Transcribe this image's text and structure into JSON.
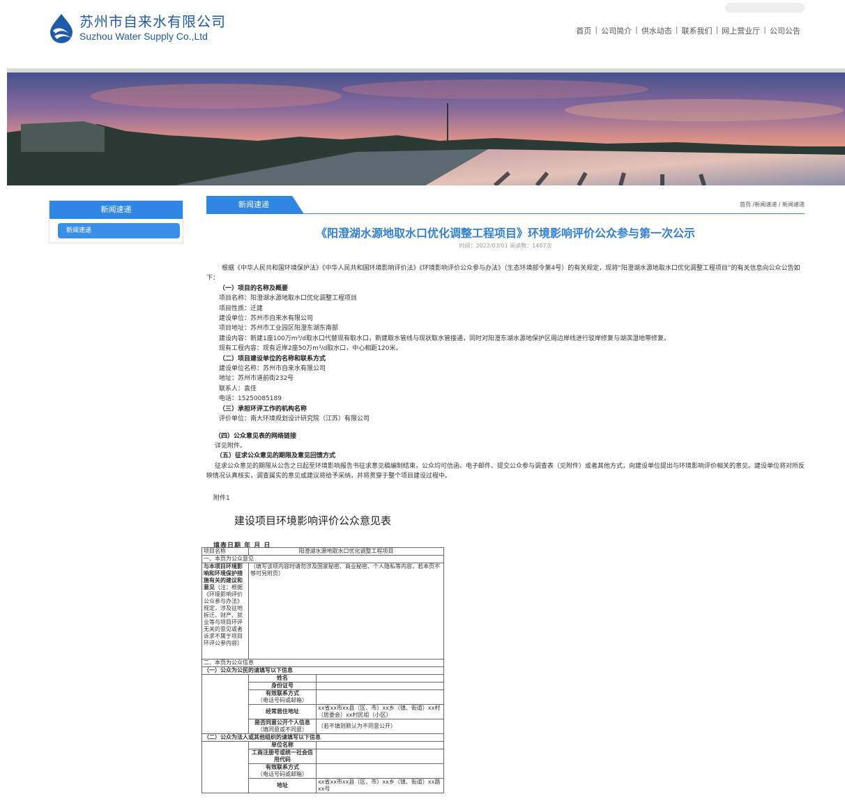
{
  "header": {
    "logo_cn": "苏州市自来水有限公司",
    "logo_en": "Suzhou Water Supply Co.,Ltd",
    "nav": [
      "首页",
      "公司简介",
      "供水动态",
      "联系我们",
      "网上营业厅",
      "公司公告"
    ]
  },
  "sidebar": {
    "title": "新闻速递",
    "items": [
      "新闻速递"
    ]
  },
  "content": {
    "tab": "新闻速递",
    "breadcrumb": "首页 /新闻速递 / 新闻速递",
    "title": "《阳澄湖水源地取水口优化调整工程项目》环境影响评价公众参与第一次公示",
    "meta": "时间：2022/03/01   阅读数：1407次",
    "intro": "根据《中华人民共和国环境保护法》《中华人民共和国环境影响评价法》《环境影响评价公众参与办法》（生态环境部令第4号）的有关规定，现将“阳澄湖水源地取水口优化调整工程项目”的有关信息向公众公告如下：",
    "s1_title": "（一）项目的名称及概要",
    "s1_lines": [
      "项目名称：阳澄湖水源地取水口优化调整工程项目",
      "项目性质：迁建",
      "建设单位：苏州市自来水有限公司",
      "项目地址：苏州市工业园区阳澄东湖东南部",
      "建设内容：新建1座100万m³/d取水口代替现有取水口，新建取水管线与现状取水管接通，同时对阳澄东湖水源地保护区周边岸线进行驳岸修复与湖滨湿地带修复。",
      "现有工程内容：现有近岸2座50万m³/d取水口，中心相距120米。"
    ],
    "s2_title": "（二）项目建设单位的名称和联系方式",
    "s2_lines": [
      "建设单位名称：苏州市自来水有限公司",
      "地址：苏州市道前街232号",
      "联系人：袁佳",
      "电话：15250085189"
    ],
    "s3_title": "（三）承担环评工作的机构名称",
    "s3_lines": [
      "评价单位：南大环境规划设计研究院（江苏）有限公司"
    ],
    "s4_title": "（四）公众意见表的网络链接",
    "s4_lines": [
      "详见附件。"
    ],
    "s5_title": "（五）征求公众意见的期限及意见回馈方式",
    "s5_text": "征求公众意见的期限从公告之日起至环境影响报告书征求意见稿编制结束，公众均可信函、电子邮件、提交公众参与调查表（见附件）或者其他方式，向建设单位提出与环境影响评价相关的意见。建设单位将对所反映情况认真核实，调查属实的意见或建议将给予采纳，并将贯穿于整个项目建设过程中。",
    "attachment": "附件1",
    "form_title": "建设项目环境影响评价公众意见表",
    "fill_date": "填表日期    年    月    日"
  },
  "form": {
    "project_label": "项目名称",
    "project_value": "阳澄湖水源地取水口优化调整工程项目",
    "sec1": "一、本页为公众意见",
    "opinion_label_bold": "与本项目环境影响和环境保护措施有关的建议和意见",
    "opinion_label_note": "（注：根据《环境影响评价公众参与办法》规定，涉及征地拆迁、财产、就业等与项目环评无关的意见或者诉求不属于项目环评公参内容）",
    "opinion_hint": "（填写该项内容时请勿涉及国家秘密、商业秘密、个人隐私等内容，若本页不够可另附页）",
    "sec2": "二、本页为公众信息",
    "citizen_title": "（一）公众为公民的请填写以下信息",
    "name_label": "姓名",
    "id_label": "身份证号",
    "contact_label": "有效联系方式",
    "contact_sub": "（电话号码或邮箱）",
    "residence_label": "经常居住地址",
    "residence_value": "xx省xx市xx县（区、市）xx乡（镇、街道）xx村（居委会）xx村民组（小区）",
    "consent_label": "是否同意公开个人信息",
    "consent_sub": "（填同意或不同意）",
    "consent_value": "（若不填则默认为不同意公开）",
    "org_title": "（二）公众为法人或其他组织的请填写以下信息",
    "org_name_label": "单位名称",
    "reg_label": "工商注册号或统一社会信用代码",
    "org_contact_label": "有效联系方式",
    "org_contact_sub": "（电话号码或邮箱）",
    "addr_label": "地址",
    "addr_value": "xx省xx市xx县（区、市）xx乡（镇、街道）xx路xx号"
  }
}
